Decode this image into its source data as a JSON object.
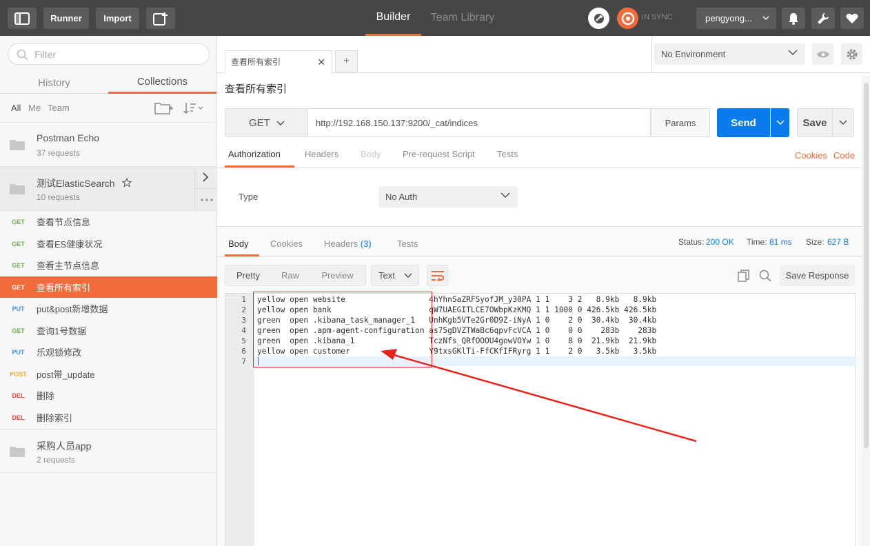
{
  "topbar": {
    "runner_label": "Runner",
    "import_label": "Import",
    "tab_builder": "Builder",
    "tab_team_library": "Team Library",
    "sync_status": "IN SYNC",
    "user_name": "pengyong..."
  },
  "sidebar": {
    "filter_placeholder": "Filter",
    "tab_history": "History",
    "tab_collections": "Collections",
    "filter_all": "All",
    "filter_me": "Me",
    "filter_team": "Team",
    "collections": [
      {
        "name": "Postman Echo",
        "requests": "37 requests"
      },
      {
        "name": "测试ElasticSearch",
        "requests": "10 requests"
      },
      {
        "name": "采购人员app",
        "requests": "2 requests"
      }
    ],
    "requests": [
      {
        "method": "GET",
        "name": "查看节点信息"
      },
      {
        "method": "GET",
        "name": "查看ES健康状况"
      },
      {
        "method": "GET",
        "name": "查看主节点信息"
      },
      {
        "method": "GET",
        "name": "查看所有索引"
      },
      {
        "method": "PUT",
        "name": "put&post新增数据"
      },
      {
        "method": "GET",
        "name": "查询1号数据"
      },
      {
        "method": "PUT",
        "name": "乐观锁修改"
      },
      {
        "method": "POST",
        "name": "post带_update"
      },
      {
        "method": "DEL",
        "name": "删除"
      },
      {
        "method": "DEL",
        "name": "删除索引"
      }
    ]
  },
  "main": {
    "tab_label": "查看所有索引",
    "add_tab": "+",
    "environment": "No Environment",
    "request_title": "查看所有索引",
    "method": "GET",
    "url": "http://192.168.150.137:9200/_cat/indices",
    "params_label": "Params",
    "send_label": "Send",
    "save_label": "Save",
    "option_tabs": [
      "Authorization",
      "Headers",
      "Body",
      "Pre-request Script",
      "Tests"
    ],
    "cookies_link": "Cookies",
    "code_link": "Code",
    "auth_type_label": "Type",
    "auth_type_value": "No Auth"
  },
  "response": {
    "tabs": [
      "Body",
      "Cookies",
      "Headers",
      "Tests"
    ],
    "headers_count": "(3)",
    "status_label": "Status:",
    "status_value": "200 OK",
    "time_label": "Time:",
    "time_value": "81 ms",
    "size_label": "Size:",
    "size_value": "627 B",
    "view_pretty": "Pretty",
    "view_raw": "Raw",
    "view_preview": "Preview",
    "format": "Text",
    "save_response": "Save Response",
    "lines": [
      "yellow open website                  4hYhnSaZRFSyofJM_y30PA 1 1    3 2   8.9kb   8.9kb",
      "yellow open bank                     qW7UAEGITLCE7OWbpKzKMQ 1 1 1000 0 426.5kb 426.5kb",
      "green  open .kibana_task_manager_1   UnhKgb5VTe2Gr0D9Z-iNyA 1 0    2 0  30.4kb  30.4kb",
      "green  open .apm-agent-configuration as75gDVZTWaBc6qpvFcVCA 1 0    0 0    283b    283b",
      "green  open .kibana_1                TczNfs_QRfOOOU4gowVOYw 1 0    8 0  21.9kb  21.9kb",
      "yellow open customer                 Y9txsGKlTi-FfCKfIFRyrg 1 1    2 0   3.5kb   3.5kb",
      ""
    ],
    "line_numbers": [
      "1",
      "2",
      "3",
      "4",
      "5",
      "6",
      "7"
    ]
  },
  "colors": {
    "accent_orange": "#f26b3a",
    "send_blue": "#097bed",
    "annotation_red": "#e8241a"
  }
}
